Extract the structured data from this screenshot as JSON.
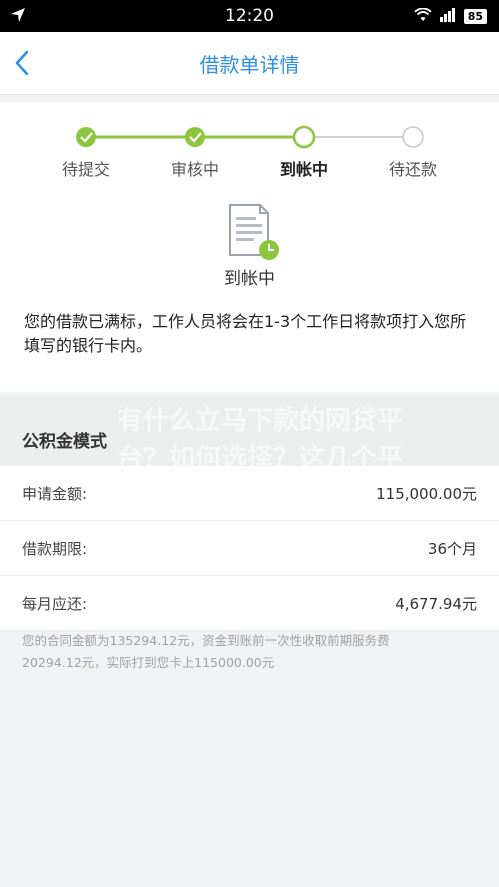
{
  "status_bar": {
    "time": "12:20",
    "battery": "85"
  },
  "nav": {
    "title": "借款单详情"
  },
  "progress": {
    "steps": [
      {
        "label": "待提交",
        "state": "done"
      },
      {
        "label": "审核中",
        "state": "done"
      },
      {
        "label": "到帐中",
        "state": "current"
      },
      {
        "label": "待还款",
        "state": "pending"
      }
    ],
    "current_title": "到帐中",
    "description": "您的借款已满标，工作人员将会在1-3个工作日将款项打入您所填写的银行卡内。"
  },
  "section": {
    "name": "公积金模式"
  },
  "watermark": {
    "line1": "有什么立马下款的网贷平",
    "line2": "台？如何选择？这几个平"
  },
  "details": [
    {
      "label": "申请金额:",
      "value": "115,000.00元"
    },
    {
      "label": "借款期限:",
      "value": "36个月"
    },
    {
      "label": "每月应还:",
      "value": "4,677.94元"
    }
  ],
  "footnote": {
    "line1": "您的合同金额为135294.12元，资金到账前一次性收取前期服务费",
    "line2": "20294.12元，实际打到您卡上115000.00元"
  },
  "colors": {
    "accent": "#2f8fe0",
    "step_done": "#8cc63f",
    "step_pending": "#c8c8c8"
  }
}
